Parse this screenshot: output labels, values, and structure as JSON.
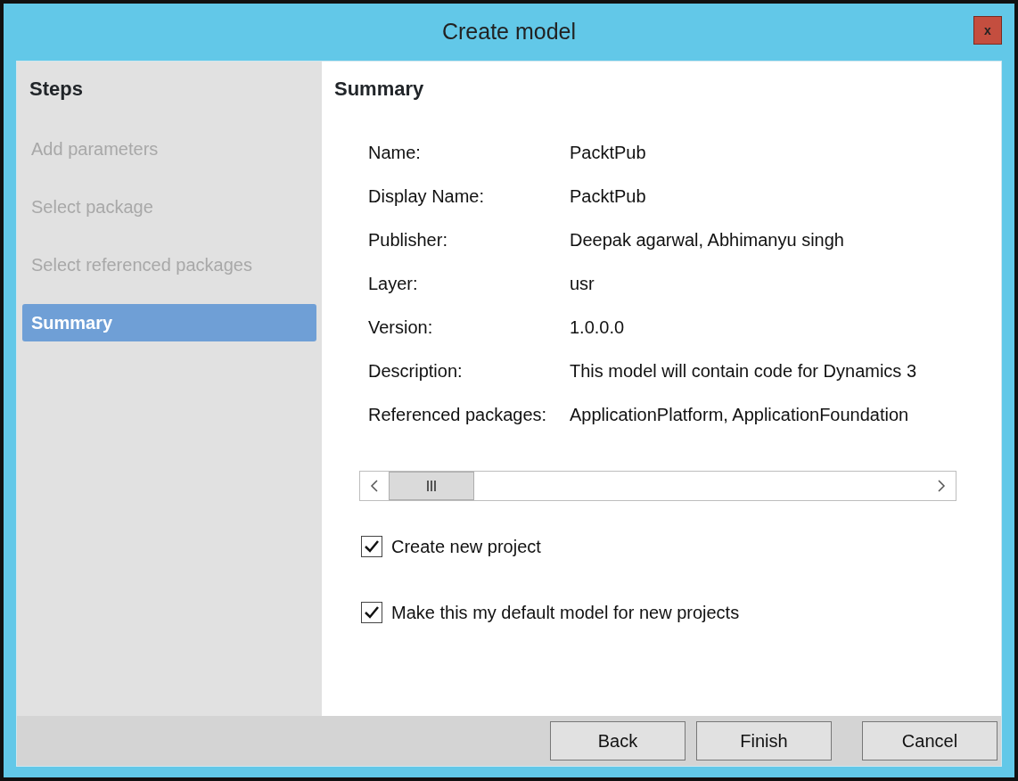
{
  "window": {
    "title": "Create model",
    "close": "x"
  },
  "sidebar": {
    "title": "Steps",
    "items": [
      {
        "label": "Add parameters",
        "selected": false
      },
      {
        "label": "Select package",
        "selected": false
      },
      {
        "label": "Select referenced packages",
        "selected": false
      },
      {
        "label": "Summary",
        "selected": true
      }
    ]
  },
  "summary": {
    "title": "Summary",
    "fields": [
      {
        "label": "Name:",
        "value": "PacktPub"
      },
      {
        "label": "Display Name:",
        "value": "PacktPub"
      },
      {
        "label": "Publisher:",
        "value": "Deepak agarwal, Abhimanyu singh"
      },
      {
        "label": "Layer:",
        "value": "usr"
      },
      {
        "label": "Version:",
        "value": "1.0.0.0"
      },
      {
        "label": "Description:",
        "value": "This model will contain code for Dynamics 3"
      },
      {
        "label": "Referenced packages:",
        "value": "ApplicationPlatform, ApplicationFoundation"
      }
    ]
  },
  "options": [
    {
      "label": "Create new project",
      "checked": true
    },
    {
      "label": "Make this my default model for new projects",
      "checked": true
    }
  ],
  "buttons": [
    "Back",
    "Finish",
    "Cancel"
  ]
}
